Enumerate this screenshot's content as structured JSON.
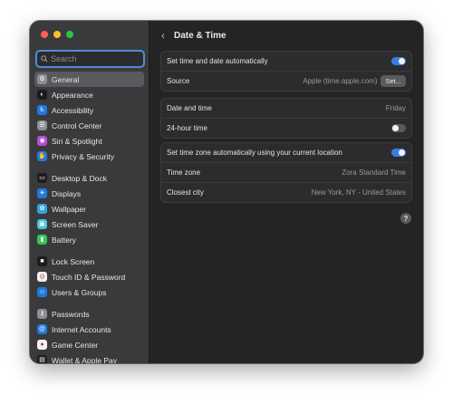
{
  "window": {
    "title": "Date & Time"
  },
  "search": {
    "placeholder": "Search",
    "value": ""
  },
  "sidebar": {
    "items": [
      {
        "label": "General",
        "icon": "gear-icon",
        "color": "#8e8e93",
        "selected": true
      },
      {
        "label": "Appearance",
        "icon": "appearance-icon",
        "color": "#1c1c1e"
      },
      {
        "label": "Accessibility",
        "icon": "accessibility-icon",
        "color": "#1f7ae0"
      },
      {
        "label": "Control Center",
        "icon": "control-center-icon",
        "color": "#8e8e93"
      },
      {
        "label": "Siri & Spotlight",
        "icon": "siri-icon",
        "color": "#b84bd6"
      },
      {
        "label": "Privacy & Security",
        "icon": "hand-icon",
        "color": "#1f7ae0"
      },
      {
        "label": "Desktop & Dock",
        "icon": "dock-icon",
        "color": "#1c1c1e"
      },
      {
        "label": "Displays",
        "icon": "display-icon",
        "color": "#1f7ae0"
      },
      {
        "label": "Wallpaper",
        "icon": "wallpaper-icon",
        "color": "#34a3e0"
      },
      {
        "label": "Screen Saver",
        "icon": "screen-saver-icon",
        "color": "#4cc3d8"
      },
      {
        "label": "Battery",
        "icon": "battery-icon",
        "color": "#34c759"
      },
      {
        "label": "Lock Screen",
        "icon": "lock-icon",
        "color": "#1c1c1e"
      },
      {
        "label": "Touch ID & Password",
        "icon": "fingerprint-icon",
        "color": "#f2f2f2"
      },
      {
        "label": "Users & Groups",
        "icon": "users-icon",
        "color": "#1f7ae0"
      },
      {
        "label": "Passwords",
        "icon": "key-icon",
        "color": "#8e8e93"
      },
      {
        "label": "Internet Accounts",
        "icon": "at-icon",
        "color": "#1f7ae0"
      },
      {
        "label": "Game Center",
        "icon": "game-center-icon",
        "color": "#f2f2f2"
      },
      {
        "label": "Wallet & Apple Pay",
        "icon": "wallet-icon",
        "color": "#1c1c1e"
      }
    ]
  },
  "groups": {
    "auto": {
      "set_auto_label": "Set time and date automatically",
      "set_auto_on": true,
      "source_label": "Source",
      "source_value": "Apple (time.apple.com)",
      "set_button": "Set..."
    },
    "datetime": {
      "date_label": "Date and time",
      "date_value": "Friday",
      "hour24_label": "24-hour time",
      "hour24_on": false
    },
    "timezone": {
      "auto_tz_label": "Set time zone automatically using your current location",
      "auto_tz_on": true,
      "tz_label": "Time zone",
      "tz_value": "Zora Standard Time",
      "city_label": "Closest city",
      "city_value": "New York, NY - United States"
    }
  },
  "help": {
    "label": "?"
  },
  "colors": {
    "accent": "#3d7de0",
    "sidebar_bg": "#3a3a3c",
    "window_bg": "#242424"
  }
}
